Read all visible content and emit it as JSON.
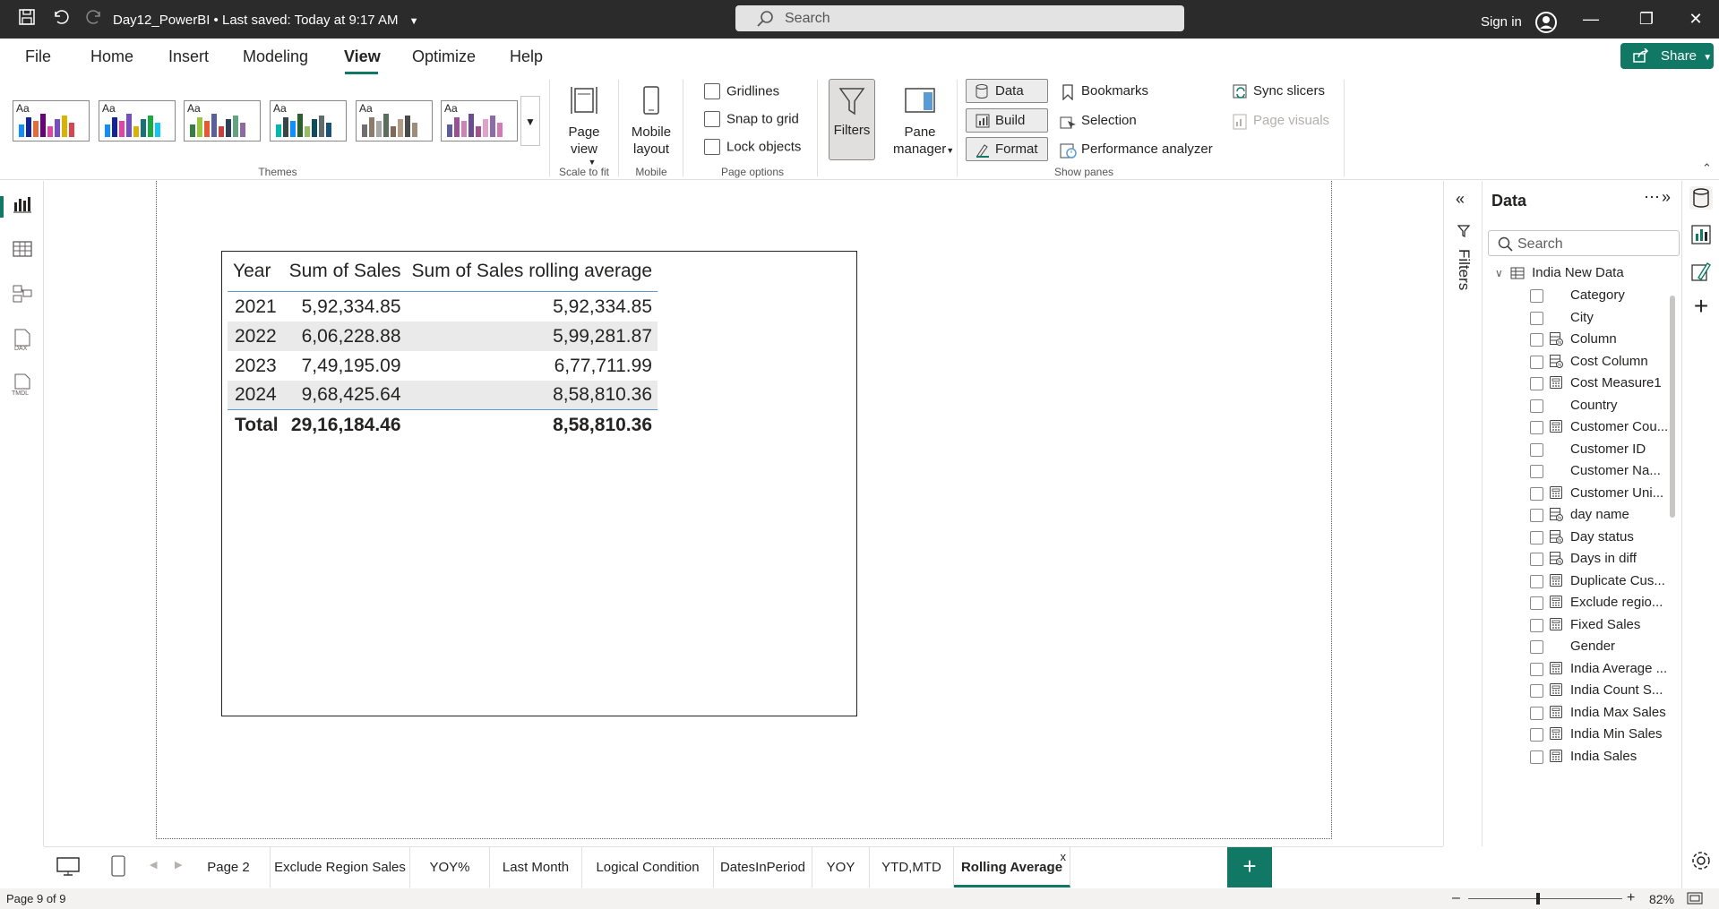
{
  "titlebar": {
    "doc_title": "Day12_PowerBI • Last saved: Today at 9:17 AM",
    "search_placeholder": "Search",
    "signin": "Sign in"
  },
  "menu": {
    "file": "File",
    "home": "Home",
    "insert": "Insert",
    "modeling": "Modeling",
    "view": "View",
    "optimize": "Optimize",
    "help": "Help",
    "share": "Share"
  },
  "ribbon": {
    "themes_label": "Themes",
    "theme_aa": "Aa",
    "page_view": "Page view",
    "scale_to_fit": "Scale to fit",
    "mobile_layout_1": "Mobile",
    "mobile_layout_2": "layout",
    "mobile_group": "Mobile",
    "gridlines": "Gridlines",
    "snap_to_grid": "Snap to grid",
    "lock_objects": "Lock objects",
    "page_options": "Page options",
    "filters": "Filters",
    "pane_manager_1": "Pane",
    "pane_manager_2": "manager",
    "data": "Data",
    "build": "Build",
    "format": "Format",
    "bookmarks": "Bookmarks",
    "selection": "Selection",
    "performance_analyzer": "Performance analyzer",
    "sync_slicers": "Sync slicers",
    "page_visuals": "Page visuals",
    "show_panes": "Show panes"
  },
  "table": {
    "headers": [
      "Year",
      "Sum of Sales",
      "Sum of Sales rolling average"
    ],
    "rows": [
      {
        "year": "2021",
        "sales": "5,92,334.85",
        "rolling": "5,92,334.85"
      },
      {
        "year": "2022",
        "sales": "6,06,228.88",
        "rolling": "5,99,281.87"
      },
      {
        "year": "2023",
        "sales": "7,49,195.09",
        "rolling": "6,77,711.99"
      },
      {
        "year": "2024",
        "sales": "9,68,425.64",
        "rolling": "8,58,810.36"
      }
    ],
    "total": {
      "label": "Total",
      "sales": "29,16,184.46",
      "rolling": "8,58,810.36"
    }
  },
  "filters_pane": {
    "label": "Filters"
  },
  "data_pane": {
    "title": "Data",
    "search_placeholder": "Search",
    "table_name": "India New Data",
    "fields": [
      {
        "name": "Category",
        "icon": "none"
      },
      {
        "name": "City",
        "icon": "none"
      },
      {
        "name": "Column",
        "icon": "calc-column-icon"
      },
      {
        "name": "Cost Column",
        "icon": "calc-column-icon"
      },
      {
        "name": "Cost Measure1",
        "icon": "measure-icon"
      },
      {
        "name": "Country",
        "icon": "none"
      },
      {
        "name": "Customer Cou...",
        "icon": "measure-icon"
      },
      {
        "name": "Customer ID",
        "icon": "none"
      },
      {
        "name": "Customer Na...",
        "icon": "none"
      },
      {
        "name": "Customer Uni...",
        "icon": "measure-icon"
      },
      {
        "name": "day name",
        "icon": "calc-column-icon"
      },
      {
        "name": "Day status",
        "icon": "calc-column-icon"
      },
      {
        "name": "Days in diff",
        "icon": "calc-column-icon"
      },
      {
        "name": "Duplicate Cus...",
        "icon": "measure-icon"
      },
      {
        "name": "Exclude regio...",
        "icon": "measure-icon"
      },
      {
        "name": "Fixed Sales",
        "icon": "measure-icon"
      },
      {
        "name": "Gender",
        "icon": "none"
      },
      {
        "name": "India Average ...",
        "icon": "measure-icon"
      },
      {
        "name": "India Count S...",
        "icon": "measure-icon"
      },
      {
        "name": "India Max Sales",
        "icon": "measure-icon"
      },
      {
        "name": "India Min Sales",
        "icon": "measure-icon"
      },
      {
        "name": "India Sales",
        "icon": "measure-icon"
      }
    ]
  },
  "pages": {
    "tabs": [
      "Page 2",
      "Exclude Region Sales",
      "YOY%",
      "Last Month",
      "Logical Condition",
      "DatesInPeriod",
      "YOY",
      "YTD,MTD",
      "Rolling Average"
    ],
    "active": "Rolling Average",
    "close": "x"
  },
  "status": {
    "page": "Page 9 of 9",
    "zoom": "82%"
  },
  "colors": {
    "accent": "#117865",
    "titlebar": "#2b2b2b",
    "table_line": "#5b9bd5"
  }
}
